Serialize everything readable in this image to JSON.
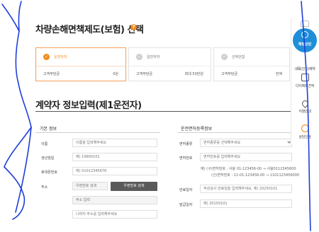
{
  "section1": {
    "title": "차량손해면책제도(보험) 선택",
    "help_glyph": "?"
  },
  "plans": [
    {
      "name": "운전자차",
      "label": "고객부담금",
      "value": "0원",
      "active": true
    },
    {
      "name": "일반자차",
      "label": "고객부담금",
      "value": "최대 50만원",
      "active": false
    },
    {
      "name": "선택안함",
      "label": "고객부담금",
      "value": "전액",
      "active": false
    }
  ],
  "section2": {
    "title": "계약자 정보입력(제1운전자)"
  },
  "basic": {
    "title": "기본 정보",
    "name_label": "이름",
    "name_placeholder": "이름을 입력해주세요",
    "birth_label": "생년월일",
    "birth_placeholder": "예) 19900101",
    "phone_label": "휴대폰번호",
    "phone_placeholder": "예) 01012345678",
    "address_label": "주소",
    "zip_placeholder": "우편번호 검색",
    "zip_button": "우편번호 검색",
    "addr1_placeholder": "주소 입력",
    "addr2_placeholder": "나머지 주소를 입력해주세요"
  },
  "license": {
    "title": "운전면허등록정보",
    "type_label": "면허종류",
    "type_placeholder": "면허종류를 선택해주세요",
    "number_label": "면허번호",
    "number_placeholder": "면허번호를 입력해주세요",
    "note_line1": "예) (구)면허번호 : 서울 01-123456-00 → 서울0112345600",
    "note_line2": "(신)면허번호 : 11-01-123456-00 → 1101123456000",
    "expiry_label": "만료일자",
    "expiry_placeholder": "적성검사 만료일을 입력해주세요. 예) 20250101",
    "issue_label": "발급일자",
    "issue_placeholder": "예) 20150101"
  },
  "quickmenu": {
    "counsel": "채팅상담",
    "items": [
      {
        "label": "내륙(인기)예약",
        "icon": "car-icon"
      },
      {
        "label": "다이렉트견적",
        "icon": "document-icon"
      },
      {
        "label": "지점안내",
        "icon": "location-pin-icon"
      },
      {
        "label": "상담신청",
        "icon": "chat-icon"
      }
    ]
  },
  "colors": {
    "accent": "#f08c1e",
    "counsel_blue": "#1f8ed8",
    "ink_scribble": "#1f3fd8"
  }
}
